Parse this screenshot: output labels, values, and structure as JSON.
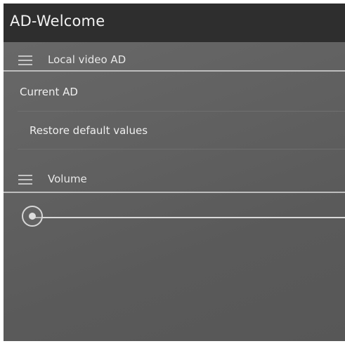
{
  "app_bar": {
    "title": "AD-Welcome"
  },
  "sections": {
    "local_video": {
      "label": "Local video AD",
      "icon": "menu-icon"
    },
    "volume": {
      "label": "Volume",
      "icon": "menu-icon"
    }
  },
  "preferences": {
    "current_ad": "Current AD",
    "restore_defaults": "Restore default values"
  },
  "volume_slider": {
    "value_fraction": 0.0
  },
  "colors": {
    "app_bar": "#2e2e2e",
    "background": "#626262",
    "text": "#efefef",
    "accent_line": "#bdbdbd"
  }
}
